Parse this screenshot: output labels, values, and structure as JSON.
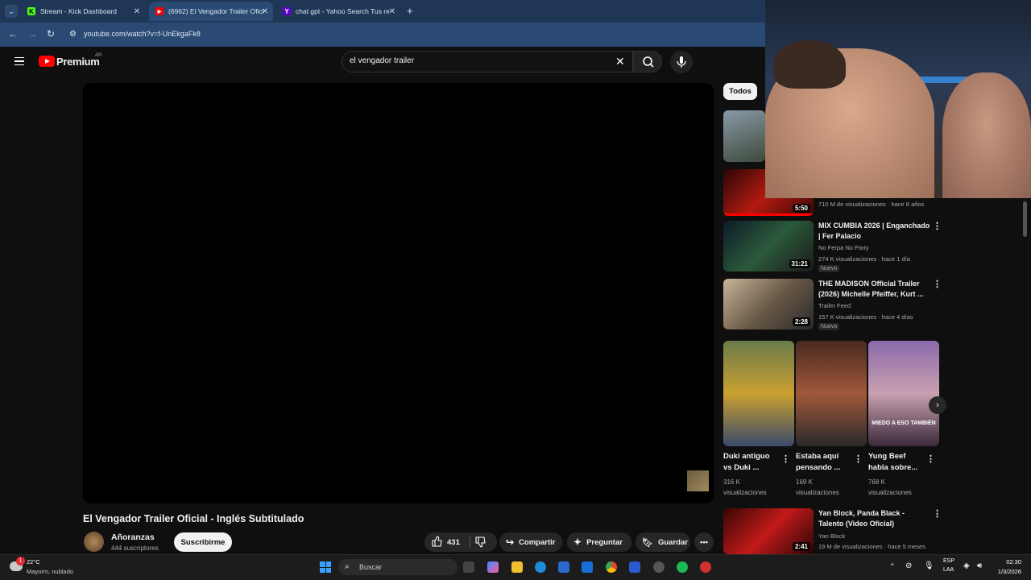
{
  "browser": {
    "tabs": [
      {
        "title": "Stream - Kick Dashboard",
        "active": false
      },
      {
        "title": "(6962) El Vengador Trailer Ofici",
        "active": true
      },
      {
        "title": "chat gpt - Yahoo Search Tus re",
        "active": false
      }
    ],
    "url": "youtube.com/watch?v=f-UnEkgaFk8"
  },
  "header": {
    "logo_text": "Premium",
    "region": "AR",
    "search_value": "el vengador trailer"
  },
  "video": {
    "title": "El Vengador Trailer Oficial - Inglés Subtitulado",
    "channel": "Añoranzas",
    "subscribers": "444 suscriptores",
    "subscribe_label": "Suscribirme",
    "likes": "431",
    "share_label": "Compartir",
    "ask_label": "Preguntar",
    "save_label": "Guardar"
  },
  "sidebar": {
    "chip": "Todos",
    "items": [
      {
        "meta2": "710 M de visualizaciones · hace 8 años",
        "duration": "5:50"
      },
      {
        "title": "MIX CUMBIA 2026 | Enganchado | Fer Palacio",
        "channel": "No Ferpa No Party",
        "meta": "274 K visualizaciones · hace 1 día",
        "badge": "Nuevo",
        "duration": "31:21"
      },
      {
        "title": "THE MADISON Official Trailer (2026) Michelle Pfeiffer, Kurt ...",
        "channel": "Trailer Feed",
        "meta": "157 K visualizaciones · hace 4 días",
        "badge": "Nuevo",
        "duration": "2:28"
      },
      {
        "title": "Yan Block, Panda Black - Talento (Video Oficial)",
        "channel": "Yan Block",
        "meta": "19 M de visualizaciones · hace 5 meses",
        "duration": "2:41"
      }
    ],
    "shorts": [
      {
        "title": "Duki antiguo vs Duki ...",
        "views": "316 K",
        "views2": "visualizaciones"
      },
      {
        "title": "Estaba aquí pensando ...",
        "views": "169 K",
        "views2": "visualizaciones"
      },
      {
        "title": "Yung Beef habla sobre...",
        "views": "768 K",
        "views2": "visualizaciones",
        "overlay": "MIEDO A ESO TAMBIÉN"
      }
    ]
  },
  "taskbar": {
    "weather_temp": "22°C",
    "weather_desc": "Mayorm. nublado",
    "search_placeholder": "Buscar",
    "lang": "ESP",
    "lang2": "LAA",
    "time": "02:30",
    "date": "1/3/2026",
    "notif": "1"
  },
  "colors": {
    "tabbar": "#1f3656",
    "addressbar": "#2a4a73",
    "yt_bg": "#0f0f0f",
    "yt_red": "#ff0000"
  }
}
